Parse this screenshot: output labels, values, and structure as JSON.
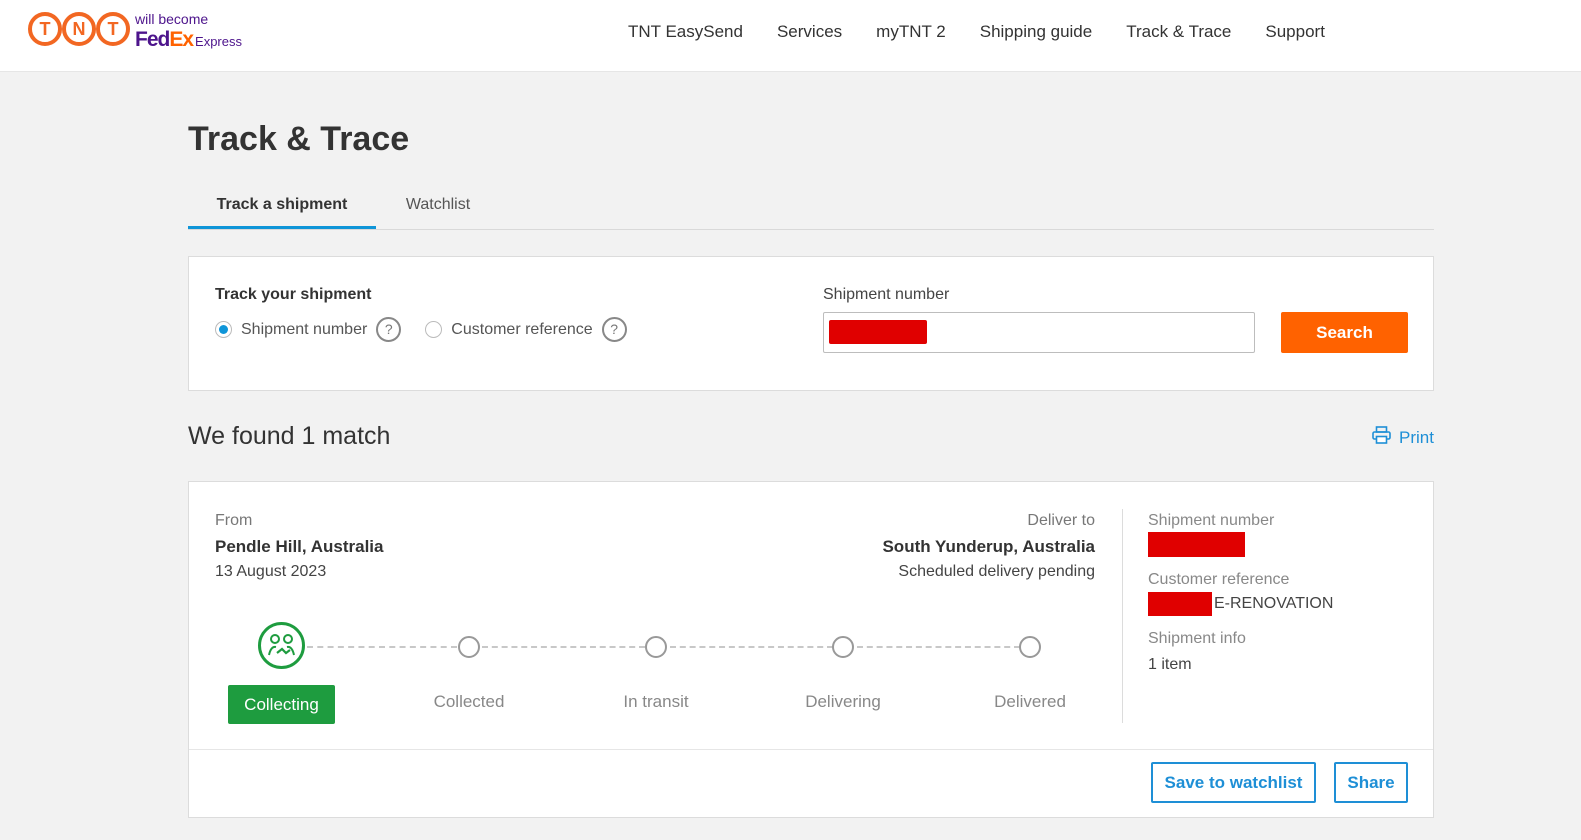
{
  "header": {
    "logo_letters": [
      "T",
      "N",
      "T"
    ],
    "logo_tagline": "will become",
    "logo_fedex_fed": "Fed",
    "logo_fedex_ex": "Ex",
    "logo_express": "Express",
    "nav": [
      "TNT EasySend",
      "Services",
      "myTNT 2",
      "Shipping guide",
      "Track & Trace",
      "Support"
    ]
  },
  "page": {
    "title": "Track & Trace",
    "tabs": [
      {
        "label": "Track a shipment",
        "active": true
      },
      {
        "label": "Watchlist",
        "active": false
      }
    ]
  },
  "search": {
    "heading": "Track your shipment",
    "options": [
      {
        "label": "Shipment number",
        "checked": true
      },
      {
        "label": "Customer reference",
        "checked": false
      }
    ],
    "help_glyph": "?",
    "field_label": "Shipment number",
    "button_label": "Search"
  },
  "results": {
    "summary": "We found 1 match",
    "print_label": "Print",
    "from_label": "From",
    "from_place": "Pendle Hill, Australia",
    "from_date": "13 August 2023",
    "to_label": "Deliver to",
    "to_place": "South Yunderup, Australia",
    "to_status": "Scheduled delivery pending",
    "shipment_number_label": "Shipment number",
    "customer_reference_label": "Customer reference",
    "customer_reference_suffix": "E-RENOVATION",
    "shipment_info_label": "Shipment info",
    "shipment_info_value": "1 item",
    "steps": [
      {
        "label": "Collecting",
        "active": true
      },
      {
        "label": "Collected",
        "active": false
      },
      {
        "label": "In transit",
        "active": false
      },
      {
        "label": "Delivering",
        "active": false
      },
      {
        "label": "Delivered",
        "active": false
      }
    ],
    "save_label": "Save to watchlist",
    "share_label": "Share"
  },
  "colors": {
    "brand_orange": "#ff6200",
    "accent_blue": "#1e8fd6",
    "active_green": "#1e9c3f",
    "redaction": "#e00000"
  }
}
